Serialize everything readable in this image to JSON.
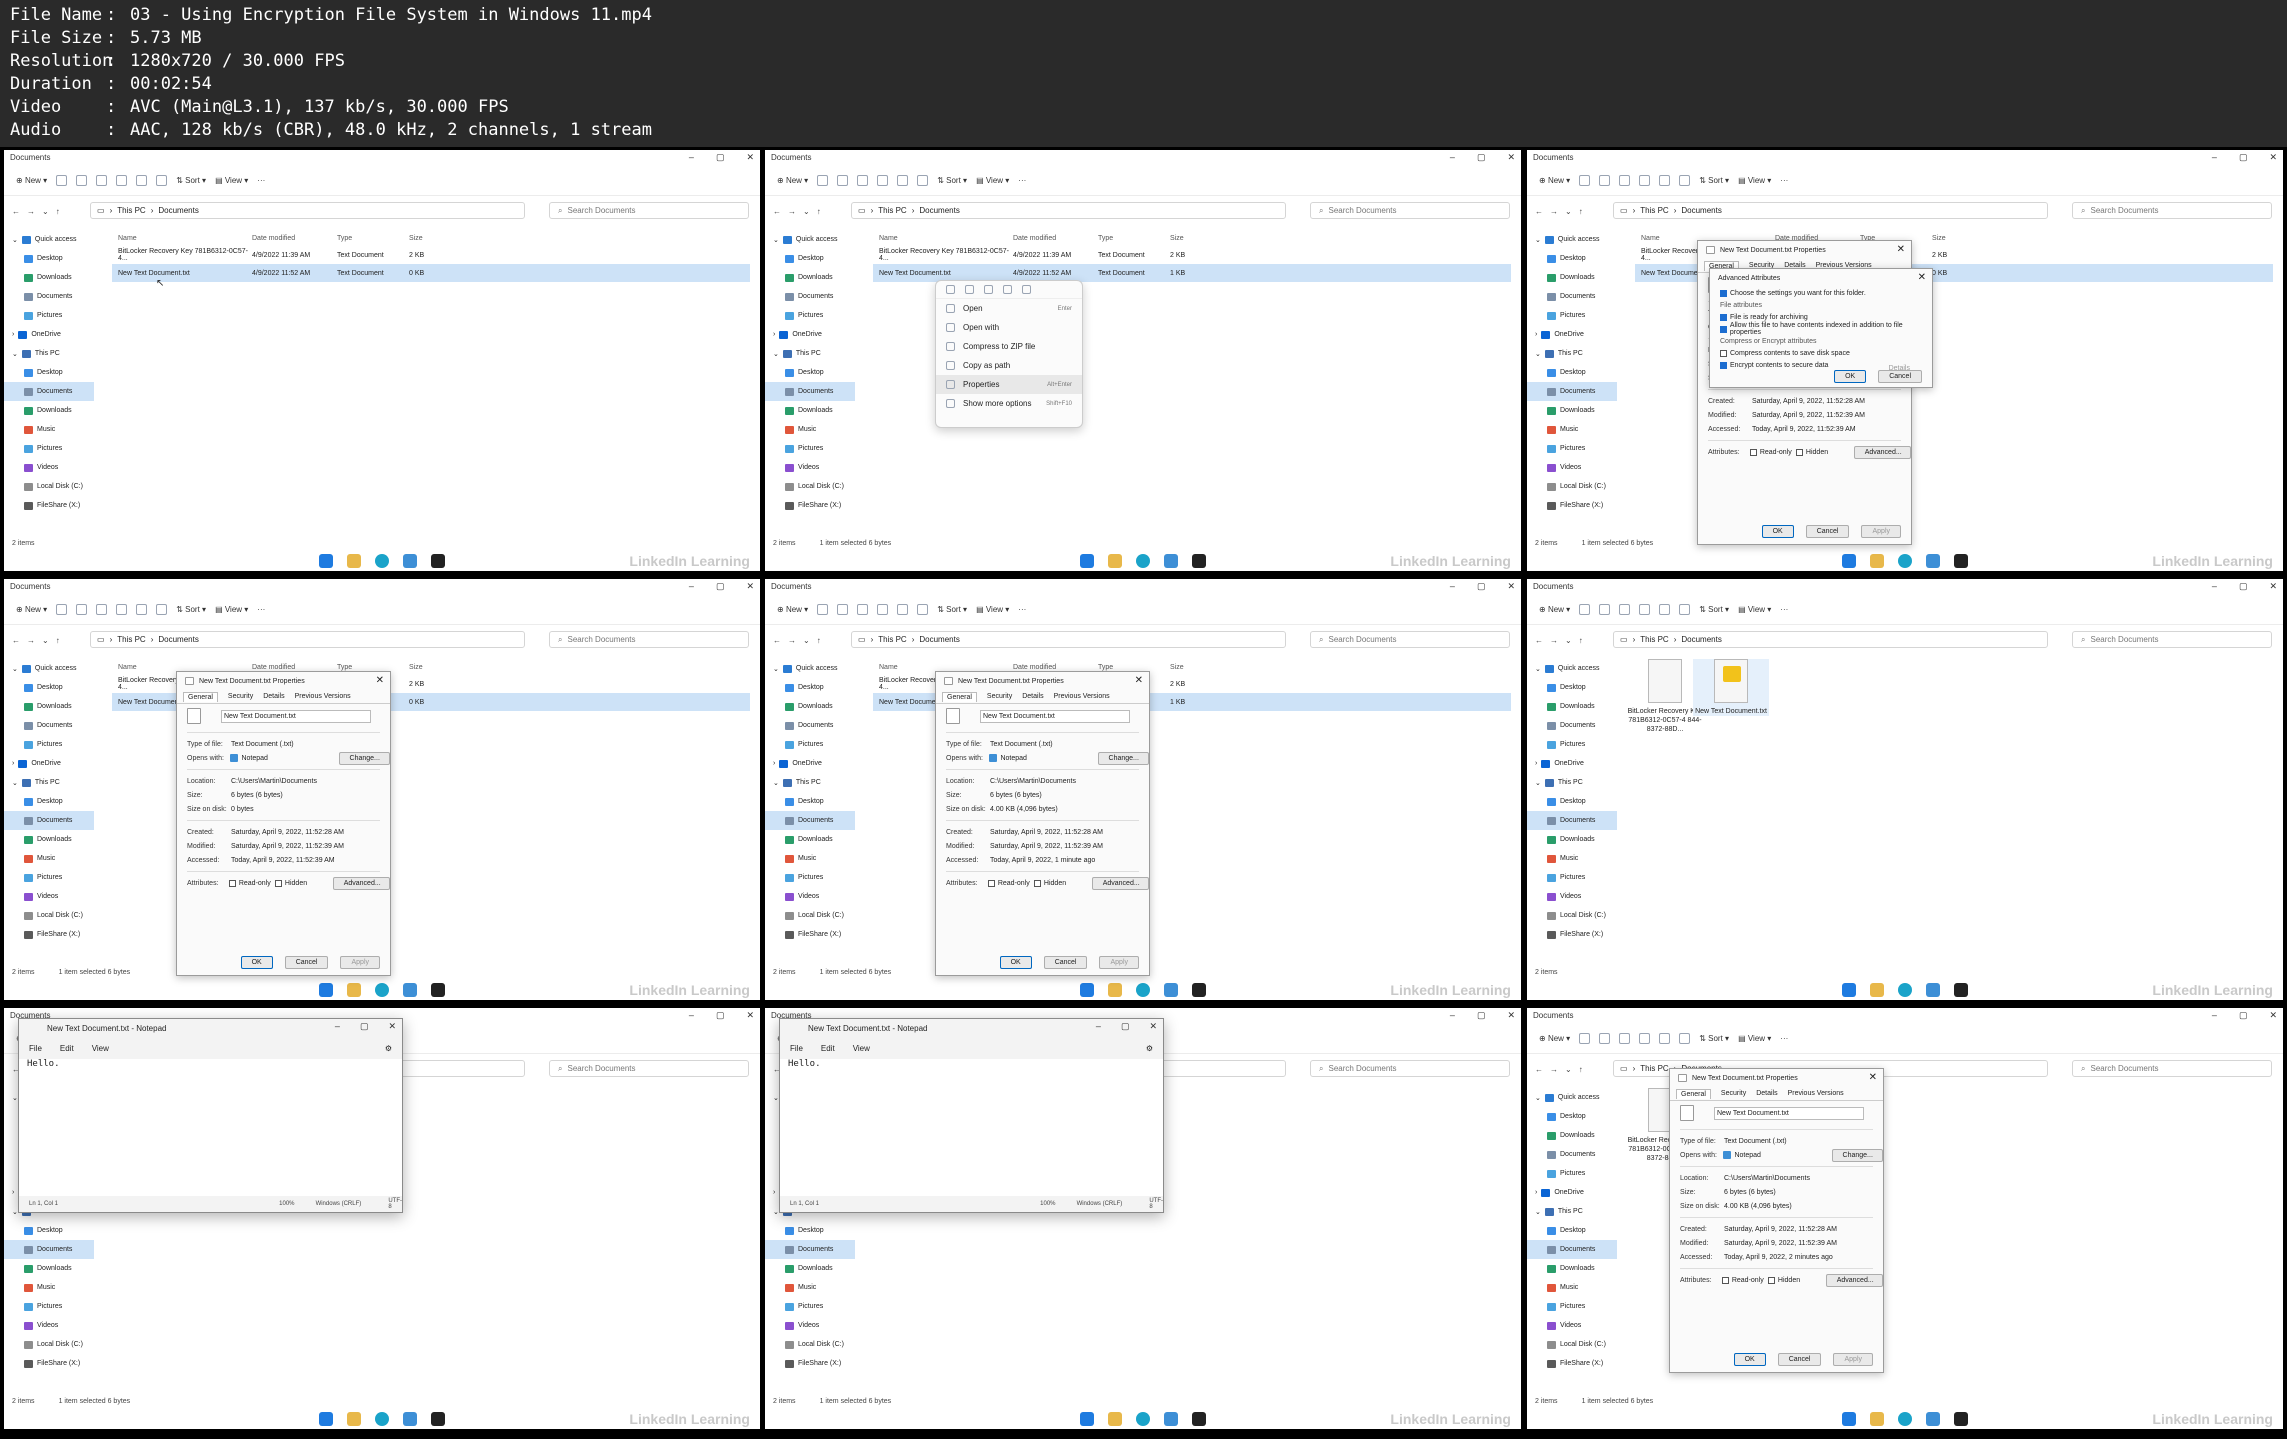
{
  "header": {
    "rows": [
      {
        "key": "File Name",
        "sep": ":",
        "val": "03 - Using Encryption File System in Windows 11.mp4"
      },
      {
        "key": "File Size",
        "sep": ":",
        "val": "5.73 MB"
      },
      {
        "key": "Resolution",
        "sep": ":",
        "val": "1280x720 / 30.000 FPS"
      },
      {
        "key": "Duration",
        "sep": ":",
        "val": "00:02:54"
      },
      {
        "key": "Video",
        "sep": ":",
        "val": "AVC (Main@L3.1), 137 kb/s, 30.000 FPS"
      },
      {
        "key": "Audio",
        "sep": ":",
        "val": "AAC, 128 kb/s (CBR), 48.0 kHz, 2 channels, 1 stream"
      }
    ]
  },
  "explorer": {
    "window_title": "Documents",
    "new_label": "New",
    "sort_label": "Sort",
    "view_label": "View",
    "breadcrumb_pc": "This PC",
    "breadcrumb_docs": "Documents",
    "search_placeholder": "Search Documents",
    "nav": {
      "quick_access": "Quick access",
      "desktop": "Desktop",
      "downloads": "Downloads",
      "documents": "Documents",
      "pictures": "Pictures",
      "onedrive": "OneDrive",
      "this_pc": "This PC",
      "music": "Music",
      "videos": "Videos",
      "local_disk": "Local Disk (C:)",
      "fileshare": "FileShare (X:)"
    },
    "cols": {
      "name": "Name",
      "date": "Date modified",
      "type": "Type",
      "size": "Size"
    },
    "files": [
      {
        "name": "BitLocker Recovery Key 781B6312-0C57-4...",
        "date": "4/9/2022 11:39 AM",
        "type": "Text Document",
        "size": "2 KB"
      },
      {
        "name": "New Text Document.txt",
        "date": "4/9/2022 11:52 AM",
        "type": "Text Document",
        "size": "0 KB",
        "size_after": "1 KB"
      }
    ],
    "files_short": [
      "BitLocker Recover",
      "New Text Documen"
    ],
    "status_items": "2 items",
    "status_selected": "1 item selected  6 bytes",
    "watermark": "LinkedIn Learning",
    "icon_caption_bitlocker": "BitLocker Recovery Key 781B6312-0C57-4 844-8372-88D...",
    "icon_caption_new": "New Text Document.txt",
    "icon_caption_new_short": "New Te Docum"
  },
  "context_menu": {
    "items": [
      {
        "label": "Open",
        "shortcut": "Enter"
      },
      {
        "label": "Open with",
        "shortcut": ""
      },
      {
        "label": "Compress to ZIP file",
        "shortcut": ""
      },
      {
        "label": "Copy as path",
        "shortcut": ""
      },
      {
        "label": "Properties",
        "shortcut": "Alt+Enter"
      },
      {
        "label": "Show more options",
        "shortcut": "Shift+F10"
      }
    ]
  },
  "advanced": {
    "title": "Advanced Attributes",
    "intro": "Choose the settings you want for this folder.",
    "file_attr_header": "File attributes",
    "archive": "File is ready for archiving",
    "index": "Allow this file to have contents indexed in addition to file properties",
    "compress_header": "Compress or Encrypt attributes",
    "compress": "Compress contents to save disk space",
    "encrypt": "Encrypt contents to secure data",
    "details": "Details",
    "ok": "OK",
    "cancel": "Cancel"
  },
  "props": {
    "title": "New Text Document.txt Properties",
    "tabs": [
      "General",
      "Security",
      "Details",
      "Previous Versions"
    ],
    "filename": "New Text Document.txt",
    "type_k": "Type of file:",
    "type_v": "Text Document (.txt)",
    "opens_k": "Opens with:",
    "opens_v": "Notepad",
    "change": "Change...",
    "loc_k": "Location:",
    "loc_v": "C:\\Users\\Martin\\Documents",
    "size_k": "Size:",
    "size_v": "6 bytes (6 bytes)",
    "disk_k": "Size on disk:",
    "disk_v0": "0 bytes",
    "disk_v1": "4.00 KB (4,096 bytes)",
    "created_k": "Created:",
    "created_v": "Saturday, April 9, 2022, 11:52:28 AM",
    "modified_k": "Modified:",
    "modified_v": "Saturday, April 9, 2022, 11:52:39 AM",
    "accessed_k": "Accessed:",
    "accessed_v0": "Today, April 9, 2022, 11:52:39 AM",
    "accessed_v1": "Today, April 9, 2022, 1 minute ago",
    "accessed_v2": "Today, April 9, 2022, 2 minutes ago",
    "attr_k": "Attributes:",
    "readonly": "Read-only",
    "hidden": "Hidden",
    "advanced": "Advanced...",
    "ok": "OK",
    "cancel": "Cancel",
    "apply": "Apply"
  },
  "notepad": {
    "title": "New Text Document.txt - Notepad",
    "menu": [
      "File",
      "Edit",
      "View"
    ],
    "body": "Hello.",
    "status_pos": "Ln 1, Col 1",
    "status_zoom": "100%",
    "status_eol": "Windows (CRLF)",
    "status_enc": "UTF-8"
  },
  "colors": {
    "selection": "#cde2f7",
    "folder": "#e8b84a",
    "accent": "#0067c0"
  }
}
